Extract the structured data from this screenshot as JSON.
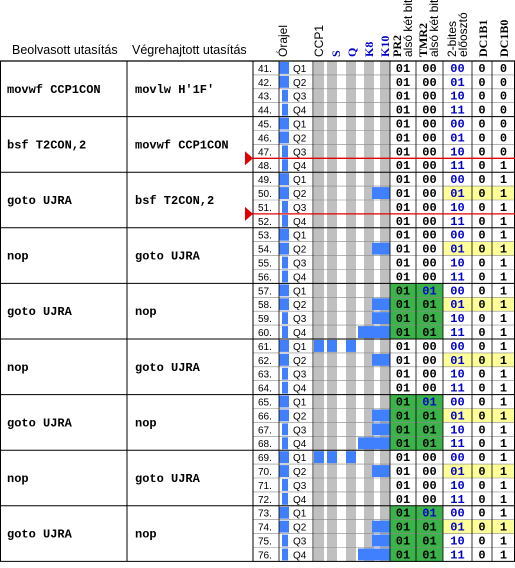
{
  "headers": {
    "read_instr": "Beolvasott utasítás",
    "exec_instr": "Végrehajtott utasítás",
    "clock": "Órajel",
    "ccp1": "CCP1",
    "s": "S",
    "q": "Q",
    "k8": "K8",
    "k10": "K10",
    "pr2_main": "PR2",
    "pr2_sub": "alsó két bit",
    "tmr2_main": "TMR2",
    "tmr2_sub": "alsó két bit",
    "presc_main": "2-bites",
    "presc_sub": "előosztó",
    "dc1b1": "DC1B1",
    "dc1b0": "DC1B0"
  },
  "colors": {
    "clock_blue": "#4080ff",
    "signal_blue": "#4080ff",
    "gray_column": "#c0c0c0",
    "green_highlight": "#3cb34a",
    "yellow_highlight": "#ffff99",
    "red_marker": "#e00000",
    "header_blue_text": "#0000cc",
    "value_blue_text": "#0000cc"
  },
  "groups": [
    {
      "read": "movwf  CCP1CON",
      "exec": "movlw  H'1F'",
      "cycle_start": 41
    },
    {
      "read": "bsf    T2CON,2",
      "exec": "movwf  CCP1CON",
      "cycle_start": 45
    },
    {
      "read": "goto   UJRA",
      "exec": "bsf    T2CON,2",
      "cycle_start": 49
    },
    {
      "read": "nop",
      "exec": "goto   UJRA",
      "cycle_start": 53
    },
    {
      "read": "goto   UJRA",
      "exec": "nop",
      "cycle_start": 57
    },
    {
      "read": "nop",
      "exec": "goto   UJRA",
      "cycle_start": 61
    },
    {
      "read": "goto   UJRA",
      "exec": "nop",
      "cycle_start": 65
    },
    {
      "read": "nop",
      "exec": "goto   UJRA",
      "cycle_start": 69
    },
    {
      "read": "goto   UJRA",
      "exec": "nop",
      "cycle_start": 73
    }
  ],
  "rows": [
    {
      "n": "41.",
      "q": "Q1",
      "ccp1": 0,
      "s": 0,
      "q_sig": 0,
      "k8": 0,
      "k10": 0,
      "pr2": "01",
      "tmr2": "00",
      "pre": "00",
      "b1": "0",
      "b0": "0",
      "green": false,
      "yellow": false
    },
    {
      "n": "42.",
      "q": "Q2",
      "ccp1": 0,
      "s": 0,
      "q_sig": 0,
      "k8": 0,
      "k10": 0,
      "pr2": "01",
      "tmr2": "00",
      "pre": "01",
      "b1": "0",
      "b0": "0",
      "green": false,
      "yellow": false
    },
    {
      "n": "43.",
      "q": "Q3",
      "ccp1": 0,
      "s": 0,
      "q_sig": 0,
      "k8": 0,
      "k10": 0,
      "pr2": "01",
      "tmr2": "00",
      "pre": "10",
      "b1": "0",
      "b0": "0",
      "green": false,
      "yellow": false
    },
    {
      "n": "44.",
      "q": "Q4",
      "ccp1": 0,
      "s": 0,
      "q_sig": 0,
      "k8": 0,
      "k10": 0,
      "pr2": "01",
      "tmr2": "00",
      "pre": "11",
      "b1": "0",
      "b0": "0",
      "green": false,
      "yellow": false
    },
    {
      "n": "45.",
      "q": "Q1",
      "ccp1": 0,
      "s": 0,
      "q_sig": 0,
      "k8": 0,
      "k10": 0,
      "pr2": "01",
      "tmr2": "00",
      "pre": "00",
      "b1": "0",
      "b0": "0",
      "green": false,
      "yellow": false
    },
    {
      "n": "46.",
      "q": "Q2",
      "ccp1": 0,
      "s": 0,
      "q_sig": 0,
      "k8": 0,
      "k10": 0,
      "pr2": "01",
      "tmr2": "00",
      "pre": "01",
      "b1": "0",
      "b0": "0",
      "green": false,
      "yellow": false
    },
    {
      "n": "47.",
      "q": "Q3",
      "ccp1": 0,
      "s": 0,
      "q_sig": 0,
      "k8": 0,
      "k10": 0,
      "pr2": "01",
      "tmr2": "00",
      "pre": "10",
      "b1": "0",
      "b0": "0",
      "green": false,
      "yellow": false
    },
    {
      "n": "48.",
      "q": "Q4",
      "ccp1": 0,
      "s": 0,
      "q_sig": 0,
      "k8": 0,
      "k10": 0,
      "pr2": "01",
      "tmr2": "00",
      "pre": "11",
      "b1": "0",
      "b0": "1",
      "green": false,
      "yellow": false
    },
    {
      "n": "49.",
      "q": "Q1",
      "ccp1": 0,
      "s": 0,
      "q_sig": 0,
      "k8": 0,
      "k10": 0,
      "pr2": "01",
      "tmr2": "00",
      "pre": "00",
      "b1": "0",
      "b0": "1",
      "green": false,
      "yellow": false
    },
    {
      "n": "50.",
      "q": "Q2",
      "ccp1": 0,
      "s": 0,
      "q_sig": 0,
      "k8": 0,
      "k10": 1,
      "pr2": "01",
      "tmr2": "00",
      "pre": "01",
      "b1": "0",
      "b0": "1",
      "green": false,
      "yellow": true
    },
    {
      "n": "51.",
      "q": "Q3",
      "ccp1": 0,
      "s": 0,
      "q_sig": 0,
      "k8": 0,
      "k10": 0,
      "pr2": "01",
      "tmr2": "00",
      "pre": "10",
      "b1": "0",
      "b0": "1",
      "green": false,
      "yellow": false
    },
    {
      "n": "52.",
      "q": "Q4",
      "ccp1": 0,
      "s": 0,
      "q_sig": 0,
      "k8": 0,
      "k10": 0,
      "pr2": "01",
      "tmr2": "00",
      "pre": "11",
      "b1": "0",
      "b0": "1",
      "green": false,
      "yellow": false
    },
    {
      "n": "53.",
      "q": "Q1",
      "ccp1": 0,
      "s": 0,
      "q_sig": 0,
      "k8": 0,
      "k10": 0,
      "pr2": "01",
      "tmr2": "00",
      "pre": "00",
      "b1": "0",
      "b0": "1",
      "green": false,
      "yellow": false
    },
    {
      "n": "54.",
      "q": "Q2",
      "ccp1": 0,
      "s": 0,
      "q_sig": 0,
      "k8": 0,
      "k10": 1,
      "pr2": "01",
      "tmr2": "00",
      "pre": "01",
      "b1": "0",
      "b0": "1",
      "green": false,
      "yellow": true
    },
    {
      "n": "55.",
      "q": "Q3",
      "ccp1": 0,
      "s": 0,
      "q_sig": 0,
      "k8": 0,
      "k10": 0,
      "pr2": "01",
      "tmr2": "00",
      "pre": "10",
      "b1": "0",
      "b0": "1",
      "green": false,
      "yellow": false
    },
    {
      "n": "56.",
      "q": "Q4",
      "ccp1": 0,
      "s": 0,
      "q_sig": 0,
      "k8": 0,
      "k10": 0,
      "pr2": "01",
      "tmr2": "00",
      "pre": "11",
      "b1": "0",
      "b0": "1",
      "green": false,
      "yellow": false
    },
    {
      "n": "57.",
      "q": "Q1",
      "ccp1": 0,
      "s": 0,
      "q_sig": 0,
      "k8": 0,
      "k10": 0,
      "pr2": "01",
      "tmr2": "01",
      "pre": "00",
      "b1": "0",
      "b0": "1",
      "green": true,
      "yellow": false
    },
    {
      "n": "58.",
      "q": "Q2",
      "ccp1": 0,
      "s": 0,
      "q_sig": 0,
      "k8": 0,
      "k10": 1,
      "pr2": "01",
      "tmr2": "01",
      "pre": "01",
      "b1": "0",
      "b0": "1",
      "green": true,
      "yellow": true
    },
    {
      "n": "59.",
      "q": "Q3",
      "ccp1": 0,
      "s": 0,
      "q_sig": 0,
      "k8": 0,
      "k10": 1,
      "pr2": "01",
      "tmr2": "01",
      "pre": "10",
      "b1": "0",
      "b0": "1",
      "green": true,
      "yellow": false
    },
    {
      "n": "60.",
      "q": "Q4",
      "ccp1": 0,
      "s": 0,
      "q_sig": 0,
      "k8": 1,
      "k10": 1,
      "pr2": "01",
      "tmr2": "01",
      "pre": "11",
      "b1": "0",
      "b0": "1",
      "green": true,
      "yellow": false
    },
    {
      "n": "61.",
      "q": "Q1",
      "ccp1": 1,
      "s": 1,
      "q_sig": 1,
      "k8": 0,
      "k10": 0,
      "pr2": "01",
      "tmr2": "00",
      "pre": "00",
      "b1": "0",
      "b0": "1",
      "green": false,
      "yellow": false
    },
    {
      "n": "62.",
      "q": "Q2",
      "ccp1": 0,
      "s": 0,
      "q_sig": 0,
      "k8": 0,
      "k10": 1,
      "pr2": "01",
      "tmr2": "00",
      "pre": "01",
      "b1": "0",
      "b0": "1",
      "green": false,
      "yellow": true
    },
    {
      "n": "63.",
      "q": "Q3",
      "ccp1": 0,
      "s": 0,
      "q_sig": 0,
      "k8": 0,
      "k10": 0,
      "pr2": "01",
      "tmr2": "00",
      "pre": "10",
      "b1": "0",
      "b0": "1",
      "green": false,
      "yellow": false
    },
    {
      "n": "64.",
      "q": "Q4",
      "ccp1": 0,
      "s": 0,
      "q_sig": 0,
      "k8": 0,
      "k10": 0,
      "pr2": "01",
      "tmr2": "00",
      "pre": "11",
      "b1": "0",
      "b0": "1",
      "green": false,
      "yellow": false
    },
    {
      "n": "65.",
      "q": "Q1",
      "ccp1": 0,
      "s": 0,
      "q_sig": 0,
      "k8": 0,
      "k10": 0,
      "pr2": "01",
      "tmr2": "01",
      "pre": "00",
      "b1": "0",
      "b0": "1",
      "green": true,
      "yellow": false
    },
    {
      "n": "66.",
      "q": "Q2",
      "ccp1": 0,
      "s": 0,
      "q_sig": 0,
      "k8": 0,
      "k10": 1,
      "pr2": "01",
      "tmr2": "01",
      "pre": "01",
      "b1": "0",
      "b0": "1",
      "green": true,
      "yellow": true
    },
    {
      "n": "67.",
      "q": "Q3",
      "ccp1": 0,
      "s": 0,
      "q_sig": 0,
      "k8": 0,
      "k10": 1,
      "pr2": "01",
      "tmr2": "01",
      "pre": "10",
      "b1": "0",
      "b0": "1",
      "green": true,
      "yellow": false
    },
    {
      "n": "68.",
      "q": "Q4",
      "ccp1": 0,
      "s": 0,
      "q_sig": 0,
      "k8": 1,
      "k10": 1,
      "pr2": "01",
      "tmr2": "01",
      "pre": "11",
      "b1": "0",
      "b0": "1",
      "green": true,
      "yellow": false
    },
    {
      "n": "69.",
      "q": "Q1",
      "ccp1": 1,
      "s": 1,
      "q_sig": 1,
      "k8": 0,
      "k10": 0,
      "pr2": "01",
      "tmr2": "00",
      "pre": "00",
      "b1": "0",
      "b0": "1",
      "green": false,
      "yellow": false
    },
    {
      "n": "70.",
      "q": "Q2",
      "ccp1": 0,
      "s": 0,
      "q_sig": 0,
      "k8": 0,
      "k10": 1,
      "pr2": "01",
      "tmr2": "00",
      "pre": "01",
      "b1": "0",
      "b0": "1",
      "green": false,
      "yellow": true
    },
    {
      "n": "71.",
      "q": "Q3",
      "ccp1": 0,
      "s": 0,
      "q_sig": 0,
      "k8": 0,
      "k10": 0,
      "pr2": "01",
      "tmr2": "00",
      "pre": "10",
      "b1": "0",
      "b0": "1",
      "green": false,
      "yellow": false
    },
    {
      "n": "72.",
      "q": "Q4",
      "ccp1": 0,
      "s": 0,
      "q_sig": 0,
      "k8": 0,
      "k10": 0,
      "pr2": "01",
      "tmr2": "00",
      "pre": "11",
      "b1": "0",
      "b0": "1",
      "green": false,
      "yellow": false
    },
    {
      "n": "73.",
      "q": "Q1",
      "ccp1": 0,
      "s": 0,
      "q_sig": 0,
      "k8": 0,
      "k10": 0,
      "pr2": "01",
      "tmr2": "01",
      "pre": "00",
      "b1": "0",
      "b0": "1",
      "green": true,
      "yellow": false
    },
    {
      "n": "74.",
      "q": "Q2",
      "ccp1": 0,
      "s": 0,
      "q_sig": 0,
      "k8": 0,
      "k10": 1,
      "pr2": "01",
      "tmr2": "01",
      "pre": "01",
      "b1": "0",
      "b0": "1",
      "green": true,
      "yellow": true
    },
    {
      "n": "75.",
      "q": "Q3",
      "ccp1": 0,
      "s": 0,
      "q_sig": 0,
      "k8": 0,
      "k10": 1,
      "pr2": "01",
      "tmr2": "01",
      "pre": "10",
      "b1": "0",
      "b0": "1",
      "green": true,
      "yellow": false
    },
    {
      "n": "76.",
      "q": "Q4",
      "ccp1": 0,
      "s": 0,
      "q_sig": 0,
      "k8": 1,
      "k10": 1,
      "pr2": "01",
      "tmr2": "01",
      "pre": "11",
      "b1": "0",
      "b0": "1",
      "green": true,
      "yellow": false
    }
  ],
  "markers": [
    {
      "after_row": "47."
    },
    {
      "after_row": "51."
    }
  ]
}
